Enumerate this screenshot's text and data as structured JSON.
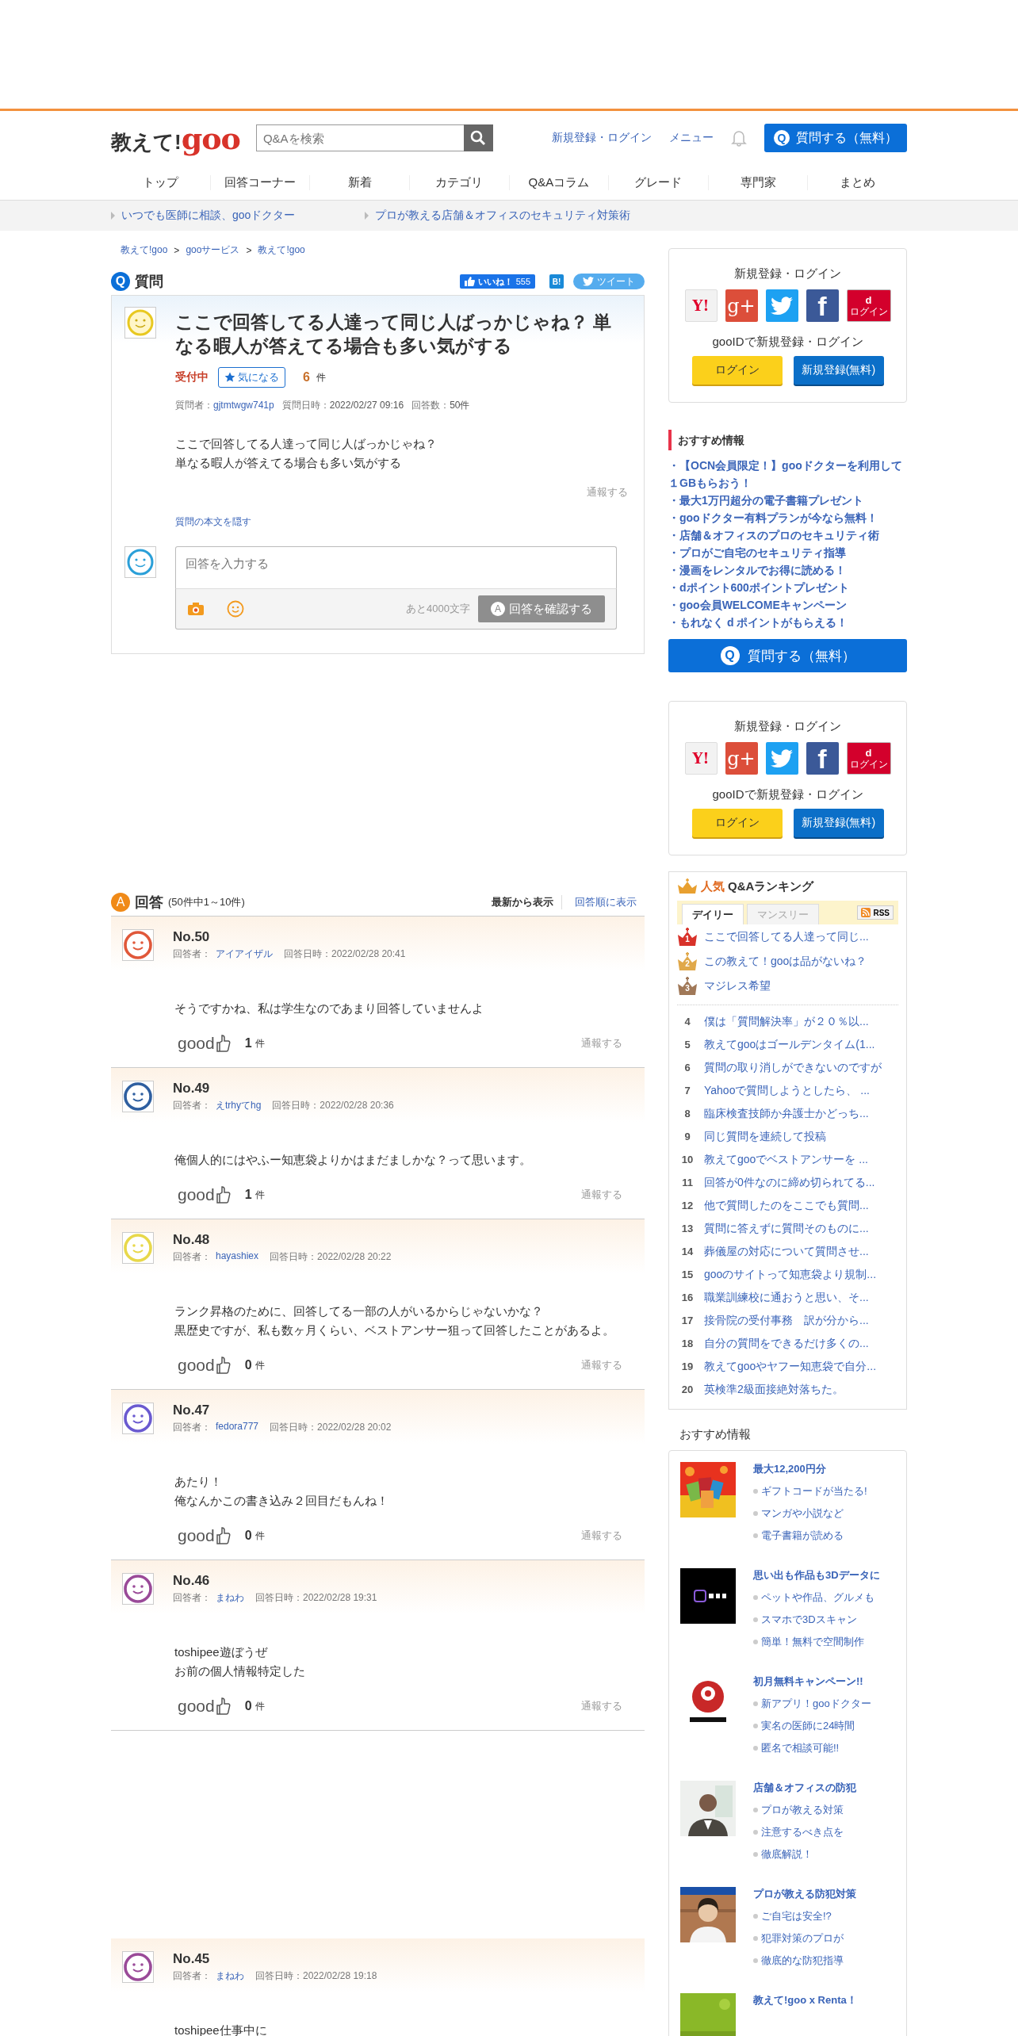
{
  "header": {
    "logo": {
      "text": "教えて!",
      "brand": "goo"
    },
    "search": {
      "placeholder": "Q&Aを検索"
    },
    "links": [
      "新規登録・ログイン",
      "メニュー"
    ],
    "ask_button": {
      "badge": "Q",
      "label": "質問する（無料）"
    }
  },
  "nav": [
    "トップ",
    "回答コーナー",
    "新着",
    "カテゴリ",
    "Q&Aコラム",
    "グレード",
    "専門家",
    "まとめ"
  ],
  "promo_links": [
    "いつでも医師に相談、gooドクター",
    "プロが教える店舗＆オフィスのセキュリティ対策術"
  ],
  "breadcrumb": {
    "items": [
      "教えて!goo",
      "gooサービス",
      "教えて!goo"
    ],
    "separator": ">"
  },
  "question": {
    "badge": "Q",
    "heading": "質問",
    "like": {
      "label": "いいね！",
      "count": "555"
    },
    "hatena": "B!",
    "tweet": "ツイート",
    "title": "ここで回答してる人達って同じ人ばっかじゃね？ 単なる暇人が答えてる場合も多い気がする",
    "status": "受付中",
    "watch_button": "気になる",
    "watch_count": "6",
    "watch_unit": "件",
    "meta": [
      {
        "label": "質問者：",
        "value": "gjtmtwgw741p",
        "kind": "link"
      },
      {
        "label": "質問日時：",
        "value": "2022/02/27 09:16",
        "kind": "plain"
      },
      {
        "label": "回答数：",
        "value": "50件",
        "kind": "plain"
      }
    ],
    "body": [
      "ここで回答してる人達って同じ人ばっかじゃね？",
      "単なる暇人が答えてる場合も多い気がする"
    ],
    "report": "通報する",
    "hide_link": "質問の本文を隠す",
    "answer_form": {
      "placeholder": "回答を入力する",
      "remaining": "あと4000文字",
      "submit": {
        "badge": "A",
        "label": "回答を確認する",
        "disabled": true
      }
    }
  },
  "answers_header": {
    "badge": "A",
    "heading": "回答",
    "count_note": "(50件中1～10件)",
    "sort": [
      {
        "label": "最新から表示",
        "selected": true
      },
      {
        "label": "回答順に表示",
        "selected": false
      }
    ]
  },
  "answers": [
    {
      "number": "No.50",
      "answerer_label": "回答者：",
      "answerer": "アイアイザル",
      "date": "回答日時：2022/02/28 20:41",
      "color": "#e0583a",
      "body": [
        "そうですかね、私は学生なのであまり回答していませんよ"
      ],
      "good_label": "good",
      "good_count": "1",
      "good_unit": "件",
      "report": "通報する"
    },
    {
      "number": "No.49",
      "answerer_label": "回答者：",
      "answerer": "えtrhyてhg",
      "date": "回答日時：2022/02/28 20:36",
      "color": "#2f5fa0",
      "body": [
        "俺個人的にはやふー知恵袋よりかはまだましかな？って思います。"
      ],
      "good_label": "good",
      "good_count": "1",
      "good_unit": "件",
      "report": "通報する"
    },
    {
      "number": "No.48",
      "answerer_label": "回答者：",
      "answerer": "hayashiex",
      "date": "回答日時：2022/02/28 20:22",
      "color": "#e8d84a",
      "body": [
        "ランク昇格のために、回答してる一部の人がいるからじゃないかな？",
        "黒歴史ですが、私も数ヶ月くらい、ベストアンサー狙って回答したことがあるよ。"
      ],
      "good_label": "good",
      "good_count": "0",
      "good_unit": "件",
      "report": "通報する"
    },
    {
      "number": "No.47",
      "answerer_label": "回答者：",
      "answerer": "fedora777",
      "date": "回答日時：2022/02/28 20:02",
      "color": "#6a5ad0",
      "body": [
        "あたり！",
        "俺なんかこの書き込み２回目だもんね！"
      ],
      "good_label": "good",
      "good_count": "0",
      "good_unit": "件",
      "report": "通報する"
    },
    {
      "number": "No.46",
      "answerer_label": "回答者：",
      "answerer": "まねわ",
      "date": "回答日時：2022/02/28 19:31",
      "color": "#9a4a98",
      "body": [
        "toshipee遊ぼうぜ",
        "お前の個人情報特定した"
      ],
      "good_label": "good",
      "good_count": "0",
      "good_unit": "件",
      "report": "通報する"
    },
    {
      "number": "No.45",
      "answerer_label": "回答者：",
      "answerer": "まねわ",
      "date": "回答日時：2022/02/28 19:18",
      "color": "#9a4a98",
      "body": [
        "toshipee仕事中に"
      ]
    }
  ],
  "sidebar": [
    {
      "kind": "login",
      "title": "新規登録・ログイン",
      "social": [
        {
          "kind": "yahoo",
          "label": "Y!"
        },
        {
          "kind": "google",
          "label": "g+"
        },
        {
          "kind": "twitter"
        },
        {
          "kind": "facebook",
          "label": "f"
        },
        {
          "kind": "docomo",
          "label": "d",
          "sub": "ログイン"
        }
      ],
      "goo_id": "gooIDで新規登録・ログイン",
      "buttons": [
        {
          "kind": "login",
          "label": "ログイン"
        },
        {
          "kind": "register",
          "label": "新規登録(無料)"
        }
      ]
    },
    {
      "kind": "recommend",
      "title": "おすすめ情報",
      "items": [
        "・【OCN会員限定！】gooドクターを利用して１GBもらおう！",
        "・最大1万円超分の電子書籍プレゼント",
        "・gooドクター有料プランが今なら無料！",
        "・店舗＆オフィスのプロのセキュリティ術",
        "・プロがご自宅のセキュリティ指導",
        "・漫画をレンタルでお得に読める！",
        "・dポイント600ポイントプレゼント",
        "・goo会員WELCOMEキャンペーン",
        "・もれなく d ポイントがもらえる！"
      ]
    },
    {
      "kind": "ask",
      "badge": "Q",
      "label": "質問する（無料）"
    },
    {
      "kind": "login",
      "title": "新規登録・ログイン",
      "social": [
        {
          "kind": "yahoo",
          "label": "Y!"
        },
        {
          "kind": "google",
          "label": "g+"
        },
        {
          "kind": "twitter"
        },
        {
          "kind": "facebook",
          "label": "f"
        },
        {
          "kind": "docomo",
          "label": "d",
          "sub": "ログイン"
        }
      ],
      "goo_id": "gooIDで新規登録・ログイン",
      "buttons": [
        {
          "kind": "login",
          "label": "ログイン"
        },
        {
          "kind": "register",
          "label": "新規登録(無料)"
        }
      ]
    },
    {
      "kind": "ranking",
      "title_accent": "人気",
      "title": "Q&Aランキング",
      "tabs": [
        {
          "label": "デイリー",
          "selected": true
        },
        {
          "label": "マンスリー",
          "selected": false
        }
      ],
      "rss": "RSS",
      "items": [
        {
          "rank": "1",
          "title": "ここで回答してる人達って同じ...",
          "color": "#d8322a"
        },
        {
          "rank": "2",
          "title": "この教えて！gooは品がないね？",
          "color": "#e0a84a"
        },
        {
          "rank": "3",
          "title": "マジレス希望",
          "color": "#a07858"
        },
        {
          "rank": "4",
          "title": "僕は「質問解決率」が２０％以..."
        },
        {
          "rank": "5",
          "title": "教えてgooはゴールデンタイム(1..."
        },
        {
          "rank": "6",
          "title": "質問の取り消しができないのですが"
        },
        {
          "rank": "7",
          "title": "Yahooで質問しようとしたら、 ..."
        },
        {
          "rank": "8",
          "title": "臨床検査技師か弁護士かどっち..."
        },
        {
          "rank": "9",
          "title": "同じ質問を連続して投稿"
        },
        {
          "rank": "10",
          "title": "教えてgooでベストアンサーを ..."
        },
        {
          "rank": "11",
          "title": "回答が0件なのに締め切られてる..."
        },
        {
          "rank": "12",
          "title": "他で質問したのをここでも質問..."
        },
        {
          "rank": "13",
          "title": "質問に答えずに質問そのものに..."
        },
        {
          "rank": "14",
          "title": "葬儀屋の対応について質問させ..."
        },
        {
          "rank": "15",
          "title": "gooのサイトって知恵袋より規制..."
        },
        {
          "rank": "16",
          "title": "職業訓練校に通おうと思い、そ..."
        },
        {
          "rank": "17",
          "title": "接骨院の受付事務　訳が分から..."
        },
        {
          "rank": "18",
          "title": "自分の質問をできるだけ多くの..."
        },
        {
          "rank": "19",
          "title": "教えてgooやヤフー知恵袋で自分..."
        },
        {
          "rank": "20",
          "title": "英検準2級面接絶対落ちた。"
        }
      ]
    },
    {
      "kind": "promos",
      "title": "おすすめ情報",
      "cards": [
        {
          "title": "最大12,200円分",
          "lines": [
            "ギフトコードが当たる!",
            "マンガや小説など",
            "電子書籍が読める"
          ]
        },
        {
          "title": "思い出も作品も3Dデータに",
          "lines": [
            "ペットや作品、グルメも",
            "スマホで3Dスキャン",
            "簡単！無料で空間制作"
          ]
        },
        {
          "title": "初月無料キャンペーン!!",
          "lines": [
            "新アプリ！gooドクター",
            "実名の医師に24時間",
            "匿名で相談可能!!"
          ]
        },
        {
          "title": "店舗＆オフィスの防犯",
          "lines": [
            "プロが教える対策",
            "注意するべき点を",
            "徹底解説！"
          ]
        },
        {
          "title": "プロが教える防犯対策",
          "lines": [
            "ご自宅は安全!?",
            "犯罪対策のプロが",
            "徹底的な防犯指導"
          ]
        },
        {
          "title": "教えて!goo x Renta！"
        }
      ]
    }
  ]
}
